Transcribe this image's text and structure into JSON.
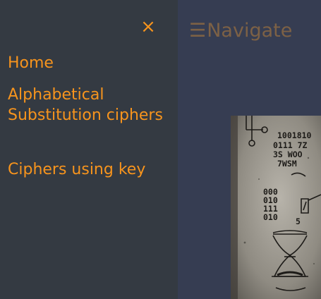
{
  "sidenav": {
    "close_icon": "×",
    "items": [
      {
        "label": "Home"
      },
      {
        "label": "Alphabetical Substitution ciphers"
      },
      {
        "label": "Ciphers using key"
      }
    ]
  },
  "header": {
    "hamburger_icon": "☰",
    "navigate_label": "Navigate"
  },
  "artwork": {
    "icon": "cipher-journal-page-image",
    "text_lines": [
      "1001810",
      "0111 7Z",
      "3S WOO",
      "7WSM",
      "000",
      "010",
      "111",
      "010",
      "5"
    ]
  },
  "colors": {
    "page_background": "#363d52",
    "sidenav_background": "#343a42",
    "accent": "#f7941d",
    "navigate_text": "#7d6145"
  }
}
